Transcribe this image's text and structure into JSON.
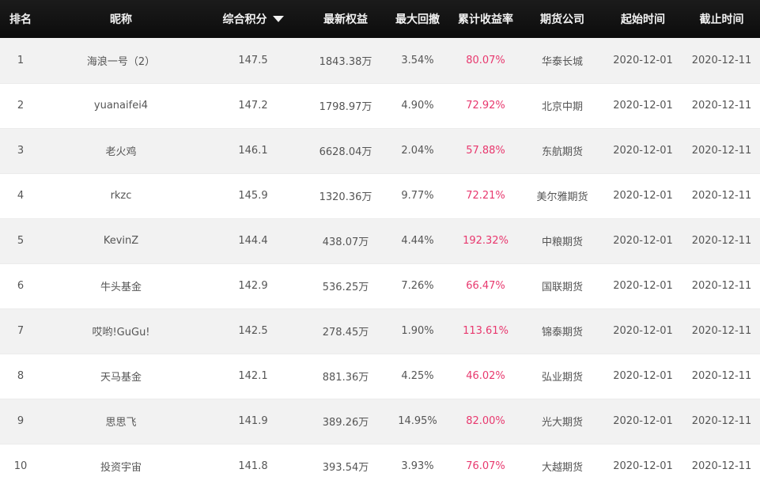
{
  "table": {
    "headers": {
      "rank": "排名",
      "nickname": "昵称",
      "score": "综合积分",
      "equity": "最新权益",
      "drawdown": "最大回撤",
      "return": "累计收益率",
      "company": "期货公司",
      "start": "起始时间",
      "end": "截止时间"
    },
    "sort_icon": "sort-desc-triangle-icon",
    "accent_color": "#e8386e",
    "rows": [
      {
        "rank": "1",
        "nickname": "海浪一号（2）",
        "score": "147.5",
        "equity": "1843.38万",
        "drawdown": "3.54%",
        "return": "80.07%",
        "company": "华泰长城",
        "start": "2020-12-01",
        "end": "2020-12-11"
      },
      {
        "rank": "2",
        "nickname": "yuanaifei4",
        "score": "147.2",
        "equity": "1798.97万",
        "drawdown": "4.90%",
        "return": "72.92%",
        "company": "北京中期",
        "start": "2020-12-01",
        "end": "2020-12-11"
      },
      {
        "rank": "3",
        "nickname": "老火鸡",
        "score": "146.1",
        "equity": "6628.04万",
        "drawdown": "2.04%",
        "return": "57.88%",
        "company": "东航期货",
        "start": "2020-12-01",
        "end": "2020-12-11"
      },
      {
        "rank": "4",
        "nickname": "rkzc",
        "score": "145.9",
        "equity": "1320.36万",
        "drawdown": "9.77%",
        "return": "72.21%",
        "company": "美尔雅期货",
        "start": "2020-12-01",
        "end": "2020-12-11"
      },
      {
        "rank": "5",
        "nickname": "KevinZ",
        "score": "144.4",
        "equity": "438.07万",
        "drawdown": "4.44%",
        "return": "192.32%",
        "company": "中粮期货",
        "start": "2020-12-01",
        "end": "2020-12-11"
      },
      {
        "rank": "6",
        "nickname": "牛头基金",
        "score": "142.9",
        "equity": "536.25万",
        "drawdown": "7.26%",
        "return": "66.47%",
        "company": "国联期货",
        "start": "2020-12-01",
        "end": "2020-12-11"
      },
      {
        "rank": "7",
        "nickname": "哎哟!GuGu!",
        "score": "142.5",
        "equity": "278.45万",
        "drawdown": "1.90%",
        "return": "113.61%",
        "company": "锦泰期货",
        "start": "2020-12-01",
        "end": "2020-12-11"
      },
      {
        "rank": "8",
        "nickname": "天马基金",
        "score": "142.1",
        "equity": "881.36万",
        "drawdown": "4.25%",
        "return": "46.02%",
        "company": "弘业期货",
        "start": "2020-12-01",
        "end": "2020-12-11"
      },
      {
        "rank": "9",
        "nickname": "思思飞",
        "score": "141.9",
        "equity": "389.26万",
        "drawdown": "14.95%",
        "return": "82.00%",
        "company": "光大期货",
        "start": "2020-12-01",
        "end": "2020-12-11"
      },
      {
        "rank": "10",
        "nickname": "投资宇宙",
        "score": "141.8",
        "equity": "393.54万",
        "drawdown": "3.93%",
        "return": "76.07%",
        "company": "大越期货",
        "start": "2020-12-01",
        "end": "2020-12-11"
      }
    ]
  }
}
